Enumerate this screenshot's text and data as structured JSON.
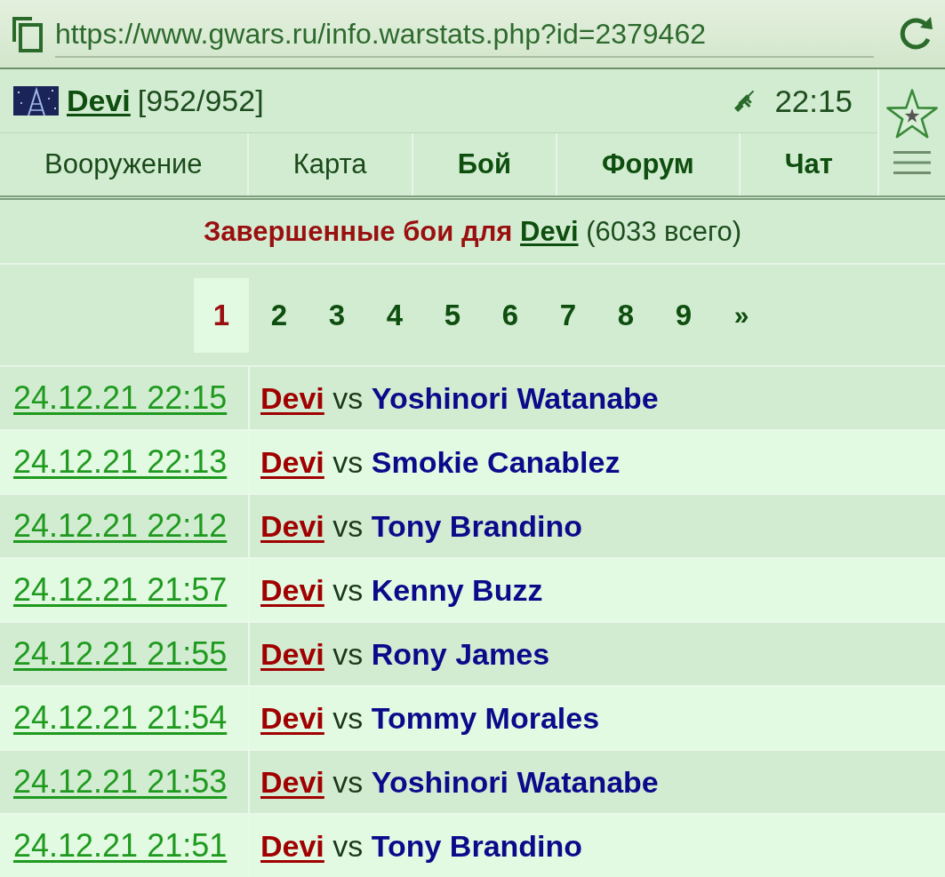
{
  "address_bar": {
    "url": "https://www.gwars.ru/info.warstats.php?id=2379462"
  },
  "player_bar": {
    "player": "Devi",
    "hp": "[952/952]",
    "time": "22:15"
  },
  "nav": [
    {
      "label": "Вооружение",
      "highlighted": false
    },
    {
      "label": "Карта",
      "highlighted": false
    },
    {
      "label": "Бой",
      "highlighted": true
    },
    {
      "label": "Форум",
      "highlighted": true
    },
    {
      "label": "Чат",
      "highlighted": true
    }
  ],
  "heading": {
    "label": "Завершенные бои для",
    "player": "Devi",
    "total": "(6033 всего)"
  },
  "pagination": [
    {
      "label": "1",
      "kind": "page",
      "selected": true
    },
    {
      "label": "2",
      "kind": "page",
      "selected": false
    },
    {
      "label": "3",
      "kind": "page",
      "selected": false
    },
    {
      "label": "4",
      "kind": "page",
      "selected": false
    },
    {
      "label": "5",
      "kind": "page",
      "selected": false
    },
    {
      "label": "6",
      "kind": "page",
      "selected": false
    },
    {
      "label": "7",
      "kind": "page",
      "selected": false
    },
    {
      "label": "8",
      "kind": "page",
      "selected": false
    },
    {
      "label": "9",
      "kind": "page",
      "selected": false
    },
    {
      "label": "»",
      "kind": "next",
      "selected": false
    }
  ],
  "battles": [
    {
      "date": "24.12.21 22:15",
      "player": "Devi",
      "versus": "vs",
      "opponent": "Yoshinori Watanabe"
    },
    {
      "date": "24.12.21 22:13",
      "player": "Devi",
      "versus": "vs",
      "opponent": "Smokie Canablez"
    },
    {
      "date": "24.12.21 22:12",
      "player": "Devi",
      "versus": "vs",
      "opponent": "Tony Brandino"
    },
    {
      "date": "24.12.21 21:57",
      "player": "Devi",
      "versus": "vs",
      "opponent": "Kenny Buzz"
    },
    {
      "date": "24.12.21 21:55",
      "player": "Devi",
      "versus": "vs",
      "opponent": "Rony James"
    },
    {
      "date": "24.12.21 21:54",
      "player": "Devi",
      "versus": "vs",
      "opponent": "Tommy Morales"
    },
    {
      "date": "24.12.21 21:53",
      "player": "Devi",
      "versus": "vs",
      "opponent": "Yoshinori Watanabe"
    },
    {
      "date": "24.12.21 21:51",
      "player": "Devi",
      "versus": "vs",
      "opponent": "Tony Brandino"
    }
  ]
}
